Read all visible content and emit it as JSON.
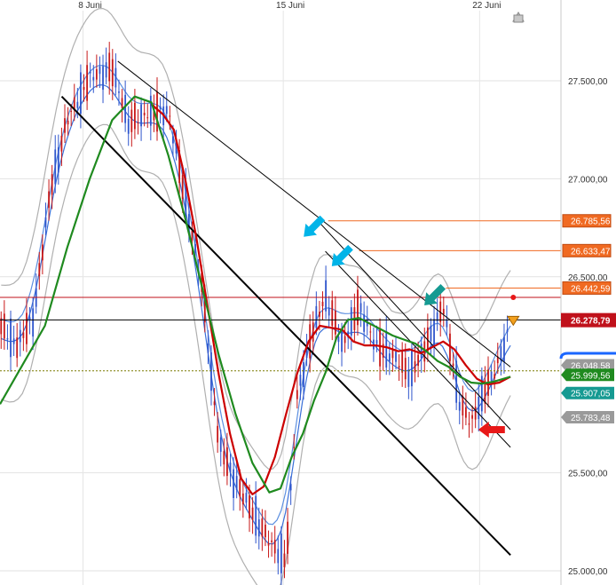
{
  "chart_data": {
    "type": "candlestick",
    "title": "",
    "xlabel": "",
    "ylabel": "",
    "x_ticks": [
      "8 Juni",
      "15 Juni",
      "22 Juni"
    ],
    "ylim": [
      24950,
      27800
    ],
    "y_ticks": [
      {
        "value": 27500,
        "label": "27.500,00"
      },
      {
        "value": 27000,
        "label": "27.000,00"
      },
      {
        "value": 26500,
        "label": "26.500,00"
      },
      {
        "value": 25500,
        "label": "25.500,00"
      },
      {
        "value": 25000,
        "label": "25.000,00"
      }
    ],
    "grid": true,
    "price_tags": [
      {
        "value": 26785.56,
        "label": "26.785,56",
        "style": "orange-line",
        "color": "#f06a22"
      },
      {
        "value": 26633.47,
        "label": "26.633,47",
        "style": "orange-line",
        "color": "#f06a22"
      },
      {
        "value": 26442.59,
        "label": "26.442,59",
        "style": "orange-line",
        "color": "#f06a22"
      },
      {
        "value": 26278.79,
        "label": "26.278,79",
        "style": "current",
        "color": "#c0111b"
      },
      {
        "value": 26048.58,
        "label": "26.048,58",
        "style": "arrow",
        "color": "#9a9a9a"
      },
      {
        "value": 25999.56,
        "label": "25.999,56",
        "style": "arrow",
        "color": "#1f8a1f"
      },
      {
        "value": 25907.05,
        "label": "25.907,05",
        "style": "arrow",
        "color": "#159a92"
      },
      {
        "value": 25783.48,
        "label": "25.783,48",
        "style": "arrow",
        "color": "#9a9a9a"
      }
    ],
    "horizontal_lines": [
      {
        "value": 26395,
        "color": "#c0111b"
      },
      {
        "value": 26280,
        "color": "#000000"
      },
      {
        "value": 26020,
        "color": "#7a7a00",
        "dashed": true
      }
    ],
    "series": [
      {
        "type": "sma",
        "color": "#cc0000",
        "x": [
          0.27,
          0.29,
          0.31,
          0.33,
          0.35,
          0.37,
          0.39,
          0.41,
          0.43,
          0.45,
          0.47,
          0.49,
          0.51,
          0.53,
          0.55,
          0.57,
          0.59,
          0.61,
          0.63,
          0.65,
          0.67,
          0.69,
          0.71,
          0.73,
          0.75,
          0.77,
          0.79,
          0.81,
          0.83,
          0.85,
          0.87,
          0.89,
          0.91
        ],
        "values": [
          27380,
          27330,
          27250,
          27000,
          26700,
          26350,
          26000,
          25700,
          25470,
          25390,
          25430,
          25580,
          25800,
          26010,
          26170,
          26250,
          26240,
          26230,
          26170,
          26150,
          26150,
          26140,
          26120,
          26130,
          26110,
          26140,
          26170,
          26130,
          26050,
          25980,
          25950,
          25960,
          25990
        ]
      },
      {
        "type": "sma",
        "color": "#1f8a1f",
        "x": [
          0.0,
          0.04,
          0.08,
          0.12,
          0.16,
          0.2,
          0.24,
          0.27,
          0.3,
          0.33,
          0.36,
          0.39,
          0.42,
          0.45,
          0.48,
          0.5,
          0.52,
          0.54,
          0.56,
          0.58,
          0.6,
          0.62,
          0.64,
          0.66,
          0.68,
          0.7,
          0.72,
          0.74,
          0.76,
          0.78,
          0.8,
          0.82,
          0.84,
          0.86,
          0.88,
          0.91
        ],
        "values": [
          25850,
          26050,
          26250,
          26650,
          27000,
          27300,
          27420,
          27390,
          27120,
          26800,
          26450,
          26100,
          25800,
          25550,
          25400,
          25420,
          25580,
          25700,
          25870,
          26010,
          26190,
          26280,
          26290,
          26260,
          26230,
          26200,
          26180,
          26160,
          26120,
          26070,
          26040,
          25990,
          25960,
          25955,
          25965,
          25990
        ]
      }
    ],
    "channels": [
      {
        "from": [
          0.11,
          27420
        ],
        "to": [
          0.91,
          25080
        ],
        "width": 2,
        "color": "#000000"
      },
      {
        "from": [
          0.21,
          27600
        ],
        "to": [
          0.91,
          26040
        ],
        "width": 1,
        "color": "#000000"
      },
      {
        "from": [
          0.57,
          26775
        ],
        "to": [
          0.91,
          25720
        ],
        "width": 1,
        "color": "#000000"
      },
      {
        "from": [
          0.58,
          26630
        ],
        "to": [
          0.91,
          25630
        ],
        "width": 1,
        "color": "#000000"
      }
    ],
    "arrows": [
      {
        "color": "#00b4e8",
        "x": 0.575,
        "value": 26800
      },
      {
        "color": "#00b4e8",
        "x": 0.625,
        "value": 26650
      },
      {
        "color": "#159a92",
        "x": 0.79,
        "value": 26450
      },
      {
        "color": "#e81818",
        "x": 0.9,
        "value": 25720
      }
    ]
  }
}
